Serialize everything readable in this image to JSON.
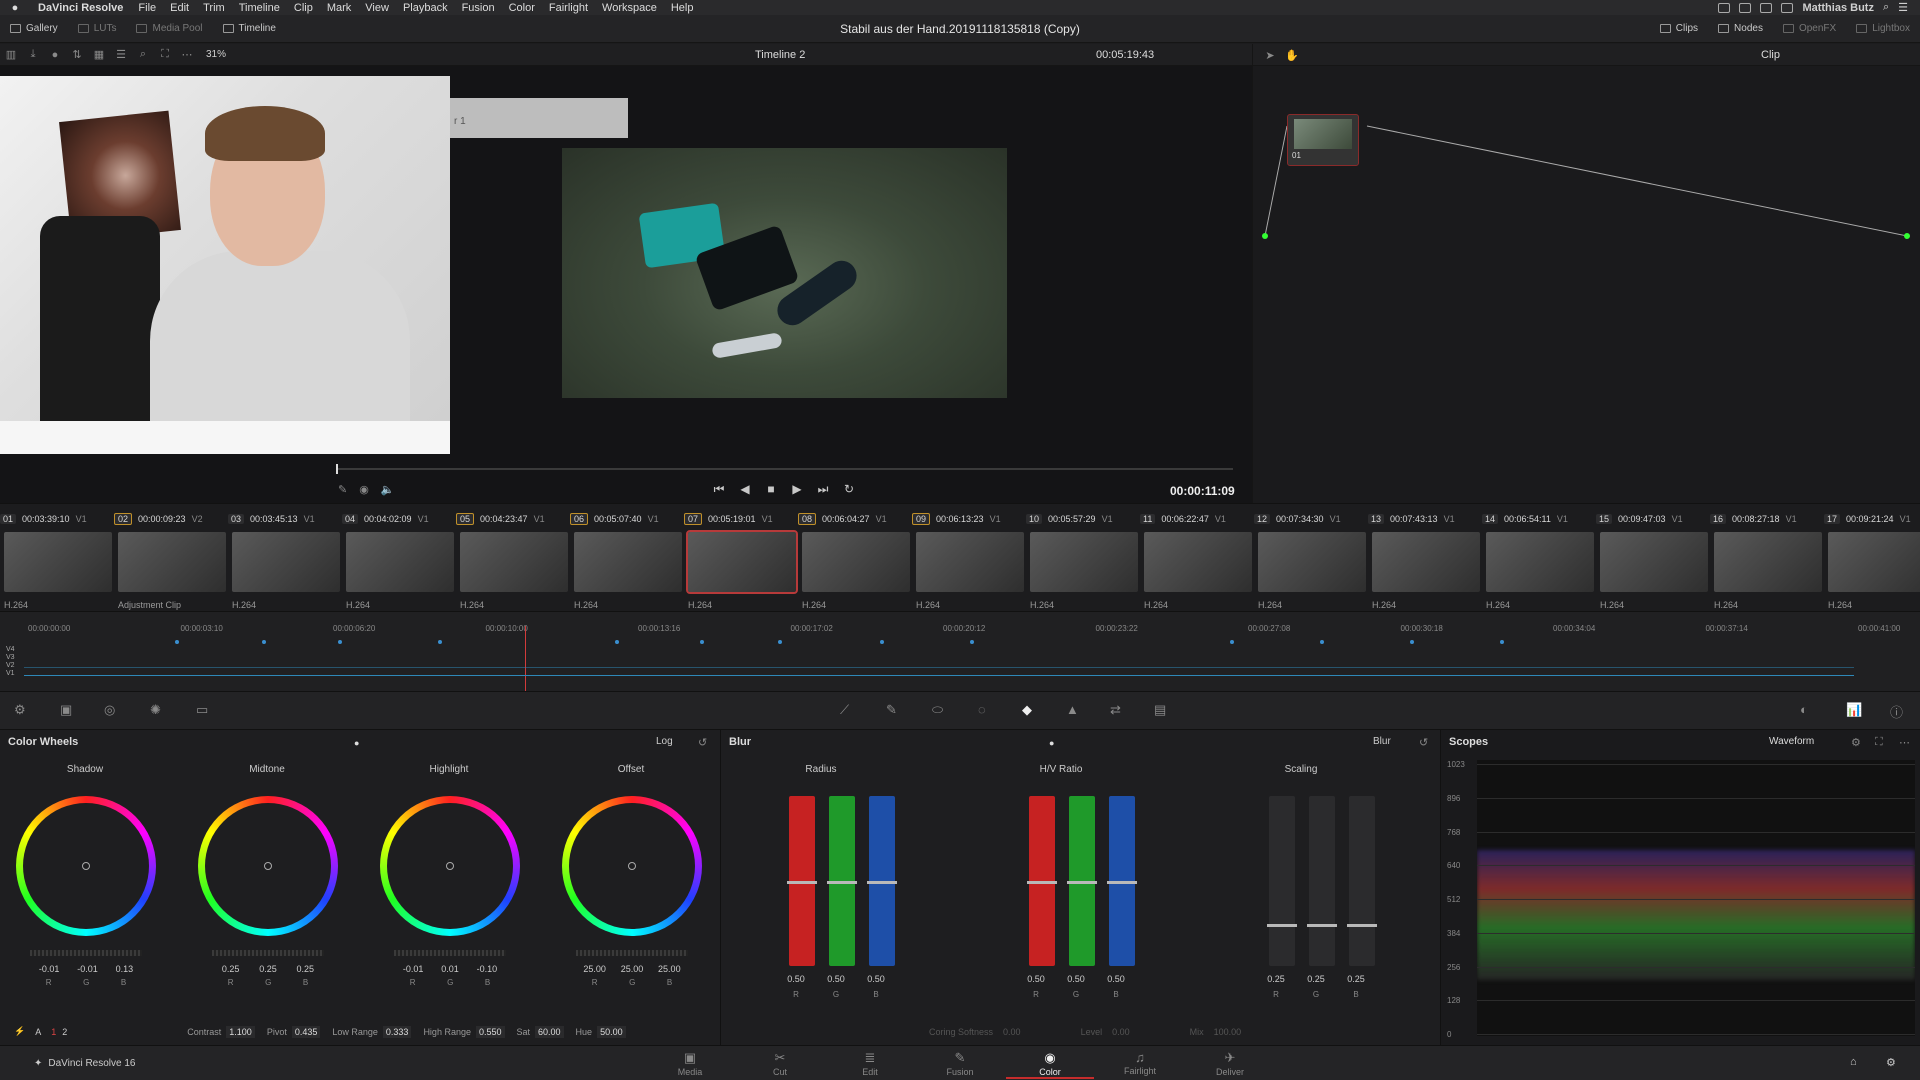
{
  "menubar": {
    "app": "DaVinci Resolve",
    "items": [
      "File",
      "Edit",
      "Trim",
      "Timeline",
      "Clip",
      "Mark",
      "View",
      "Playback",
      "Fusion",
      "Color",
      "Fairlight",
      "Workspace",
      "Help"
    ],
    "user": "Matthias Butz"
  },
  "topbar": {
    "left": [
      "Gallery",
      "LUTs",
      "Media Pool",
      "Timeline"
    ],
    "title": "Stabil aus der Hand.20191118135818 (Copy)",
    "right": [
      "Clips",
      "Nodes",
      "OpenFX",
      "Lightbox"
    ]
  },
  "viewer": {
    "zoom": "31%",
    "timeline_name": "Timeline 2",
    "timecode": "00:05:19:43",
    "transport_timecode": "00:00:11:09",
    "overlay_text": "r 1",
    "node_mode": "Clip",
    "playhead_fraction": 0.0
  },
  "nodes": {
    "label": "01"
  },
  "clips": [
    {
      "num": "01",
      "tc": "00:03:39:10",
      "trk": "V1",
      "codec": "H.264"
    },
    {
      "num": "02",
      "tc": "00:00:09:23",
      "trk": "V2",
      "codec": "Adjustment Clip",
      "sel": true
    },
    {
      "num": "03",
      "tc": "00:03:45:13",
      "trk": "V1",
      "codec": "H.264"
    },
    {
      "num": "04",
      "tc": "00:04:02:09",
      "trk": "V1",
      "codec": "H.264"
    },
    {
      "num": "05",
      "tc": "00:04:23:47",
      "trk": "V1",
      "codec": "H.264",
      "sel": true
    },
    {
      "num": "06",
      "tc": "00:05:07:40",
      "trk": "V1",
      "codec": "H.264",
      "sel": true
    },
    {
      "num": "07",
      "tc": "00:05:19:01",
      "trk": "V1",
      "codec": "H.264",
      "sel": true,
      "active": true
    },
    {
      "num": "08",
      "tc": "00:06:04:27",
      "trk": "V1",
      "codec": "H.264",
      "sel": true
    },
    {
      "num": "09",
      "tc": "00:06:13:23",
      "trk": "V1",
      "codec": "H.264",
      "sel": true
    },
    {
      "num": "10",
      "tc": "00:05:57:29",
      "trk": "V1",
      "codec": "H.264"
    },
    {
      "num": "11",
      "tc": "00:06:22:47",
      "trk": "V1",
      "codec": "H.264"
    },
    {
      "num": "12",
      "tc": "00:07:34:30",
      "trk": "V1",
      "codec": "H.264"
    },
    {
      "num": "13",
      "tc": "00:07:43:13",
      "trk": "V1",
      "codec": "H.264"
    },
    {
      "num": "14",
      "tc": "00:06:54:11",
      "trk": "V1",
      "codec": "H.264"
    },
    {
      "num": "15",
      "tc": "00:09:47:03",
      "trk": "V1",
      "codec": "H.264"
    },
    {
      "num": "16",
      "tc": "00:08:27:18",
      "trk": "V1",
      "codec": "H.264"
    },
    {
      "num": "17",
      "tc": "00:09:21:24",
      "trk": "V1",
      "codec": "H.264"
    }
  ],
  "mini_timeline": {
    "ticks": [
      "00:00:00:00",
      "00:00:03:10",
      "00:00:06:20",
      "00:00:10:00",
      "00:00:13:16",
      "00:00:17:02",
      "00:00:20:12",
      "00:00:23:22",
      "00:00:27:08",
      "00:00:30:18",
      "00:00:34:04",
      "00:00:37:14",
      "00:00:41:00"
    ],
    "tracks": [
      "V4",
      "V3",
      "V2",
      "V1"
    ]
  },
  "color_wheels": {
    "title": "Color Wheels",
    "mode": "Log",
    "wheels": [
      {
        "name": "Shadow",
        "values": [
          "-0.01",
          "-0.01",
          "0.13"
        ]
      },
      {
        "name": "Midtone",
        "values": [
          "0.25",
          "0.25",
          "0.25"
        ]
      },
      {
        "name": "Highlight",
        "values": [
          "-0.01",
          "0.01",
          "-0.10"
        ]
      },
      {
        "name": "Offset",
        "values": [
          "25.00",
          "25.00",
          "25.00"
        ]
      }
    ],
    "rgb": [
      "R",
      "G",
      "B"
    ],
    "footer": {
      "page_a": "1",
      "page_b": "2",
      "contrast_label": "Contrast",
      "contrast": "1.100",
      "pivot_label": "Pivot",
      "pivot": "0.435",
      "low_range_label": "Low Range",
      "low_range": "0.333",
      "high_range_label": "High Range",
      "high_range": "0.550",
      "sat_label": "Sat",
      "sat": "60.00",
      "hue_label": "Hue",
      "hue": "50.00"
    }
  },
  "blur": {
    "title": "Blur",
    "mode": "Blur",
    "groups": [
      {
        "name": "Radius",
        "values": [
          "0.50",
          "0.50",
          "0.50"
        ],
        "levels": [
          0.5,
          0.5,
          0.5
        ]
      },
      {
        "name": "H/V Ratio",
        "values": [
          "0.50",
          "0.50",
          "0.50"
        ],
        "levels": [
          0.5,
          0.5,
          0.5
        ]
      },
      {
        "name": "Scaling",
        "values": [
          "0.25",
          "0.25",
          "0.25"
        ],
        "levels": [
          0.25,
          0.25,
          0.25
        ]
      }
    ],
    "footer": {
      "coring_label": "Coring Softness",
      "coring": "0.00",
      "level_label": "Level",
      "level": "0.00",
      "mix_label": "Mix",
      "mix": "100.00"
    }
  },
  "scopes": {
    "title": "Scopes",
    "mode": "Waveform",
    "scale": [
      "1023",
      "896",
      "768",
      "640",
      "512",
      "384",
      "256",
      "128",
      "0"
    ]
  },
  "pagenav": {
    "brand": "DaVinci Resolve 16",
    "pages": [
      "Media",
      "Cut",
      "Edit",
      "Fusion",
      "Color",
      "Fairlight",
      "Deliver"
    ],
    "active": "Color"
  }
}
